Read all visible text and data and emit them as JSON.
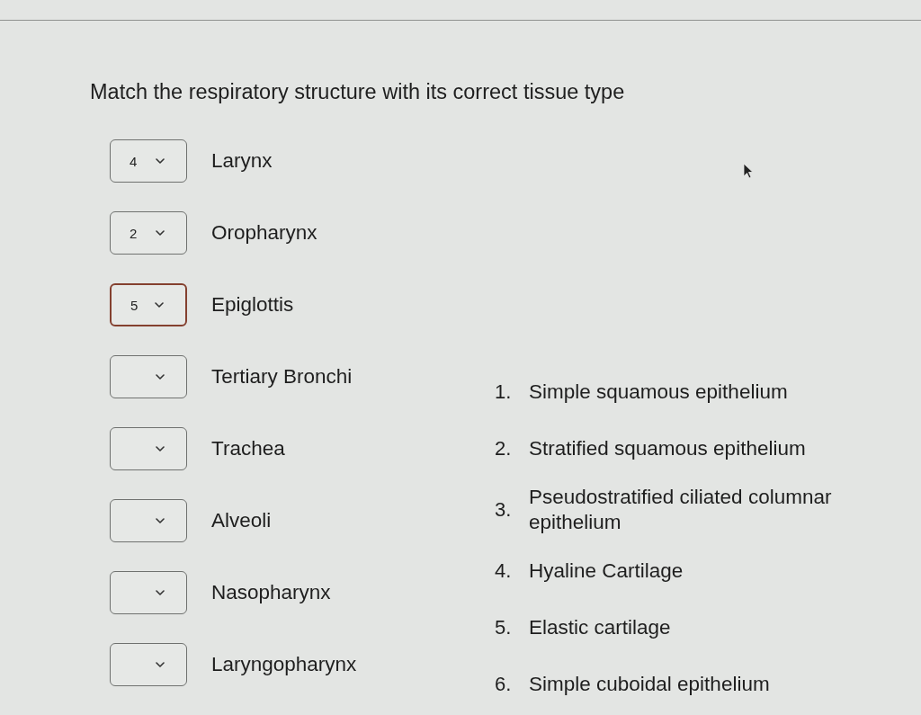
{
  "title": "Match the respiratory structure with its correct tissue type",
  "matches": [
    {
      "answer": "4",
      "label": "Larynx",
      "focused": false
    },
    {
      "answer": "2",
      "label": "Oropharynx",
      "focused": false
    },
    {
      "answer": "5",
      "label": "Epiglottis",
      "focused": true
    },
    {
      "label": "Tertiary Bronchi",
      "focused": false
    },
    {
      "label": "Trachea",
      "focused": false
    },
    {
      "label": "Alveoli",
      "focused": false
    },
    {
      "label": "Nasopharynx",
      "focused": false
    },
    {
      "label": "Laryngopharynx",
      "focused": false
    }
  ],
  "options": [
    {
      "number": "1.",
      "text": "Simple squamous epithelium"
    },
    {
      "number": "2.",
      "text": "Stratified squamous epithelium"
    },
    {
      "number": "3.",
      "text": "Pseudostratified ciliated columnar epithelium"
    },
    {
      "number": "4.",
      "text": "Hyaline Cartilage"
    },
    {
      "number": "5.",
      "text": "Elastic cartilage"
    },
    {
      "number": "6.",
      "text": "Simple cuboidal epithelium"
    }
  ]
}
